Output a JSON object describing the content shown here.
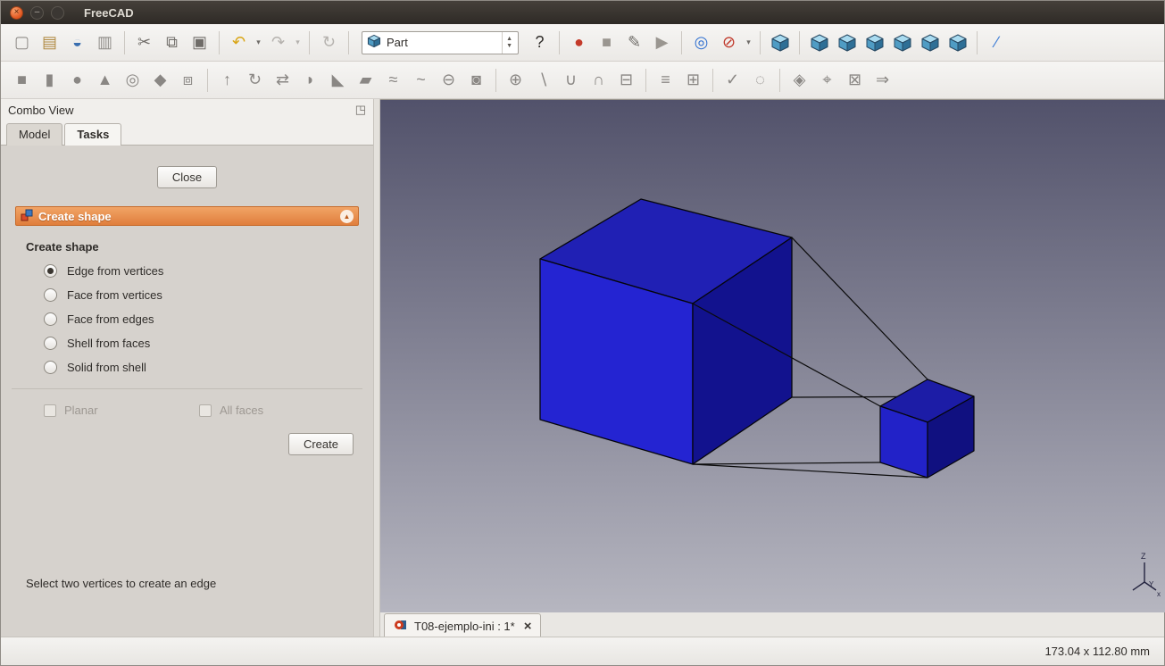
{
  "window": {
    "title": "FreeCAD"
  },
  "toolbar_main": {
    "left": [
      {
        "n": "new-document",
        "g": "▢",
        "c": "#8f8c88"
      },
      {
        "n": "open-document",
        "g": "▤",
        "c": "#b08a42"
      },
      {
        "n": "save-document",
        "g": "◒",
        "c": "#3a6fb0"
      },
      {
        "n": "print",
        "g": "▥",
        "c": "#8f8c88"
      },
      {
        "sep": true
      },
      {
        "n": "cut",
        "g": "✂",
        "c": "#6f6c68"
      },
      {
        "n": "copy",
        "g": "⧉",
        "c": "#6f6c68"
      },
      {
        "n": "paste",
        "g": "▣",
        "c": "#6f6c68"
      },
      {
        "sep": true
      },
      {
        "n": "undo",
        "g": "↶",
        "c": "#d9a514"
      },
      {
        "n": "undo-dropdown",
        "g": "▾",
        "c": "#6f6c68",
        "arrow": true
      },
      {
        "n": "redo",
        "g": "↷",
        "c": "#b5b2ae"
      },
      {
        "n": "redo-dropdown",
        "g": "▾",
        "c": "#b5b2ae",
        "arrow": true
      },
      {
        "sep": true
      },
      {
        "n": "refresh",
        "g": "↻",
        "c": "#b5b2ae"
      },
      {
        "sep": true
      }
    ],
    "workbench": {
      "value": "Part"
    },
    "right": [
      {
        "n": "whats-this",
        "g": "?",
        "c": "#2f2c29"
      },
      {
        "sep": true
      },
      {
        "n": "macro-record",
        "g": "●",
        "c": "#c43a2a"
      },
      {
        "n": "macro-stop",
        "g": "■",
        "c": "#9a9690"
      },
      {
        "n": "macro-edit",
        "g": "✎",
        "c": "#6f6c68"
      },
      {
        "n": "macro-execute",
        "g": "▶",
        "c": "#9a9690"
      },
      {
        "sep": true
      },
      {
        "n": "fit-all",
        "g": "◎",
        "c": "#2f6fd0"
      },
      {
        "n": "draw-style",
        "g": "⊘",
        "c": "#c0392b"
      },
      {
        "n": "draw-style-dropdown",
        "g": "▾",
        "c": "#6f6c68",
        "arrow": true
      },
      {
        "sep": true
      },
      {
        "n": "view-axonometric",
        "cube": true
      },
      {
        "sep": true
      },
      {
        "n": "view-front",
        "cube": true
      },
      {
        "n": "view-top",
        "cube": true
      },
      {
        "n": "view-right",
        "cube": true
      },
      {
        "n": "view-rear",
        "cube": true
      },
      {
        "n": "view-bottom",
        "cube": true
      },
      {
        "n": "view-left",
        "cube": true
      },
      {
        "sep": true
      },
      {
        "n": "measure-distance",
        "g": "∕",
        "c": "#3a7bd5"
      }
    ]
  },
  "toolbar_part": {
    "items": [
      {
        "n": "part-box",
        "g": "■",
        "c": "#8a8784"
      },
      {
        "n": "part-cylinder",
        "g": "▮",
        "c": "#8a8784"
      },
      {
        "n": "part-sphere",
        "g": "●",
        "c": "#8a8784"
      },
      {
        "n": "part-cone",
        "g": "▲",
        "c": "#8a8784"
      },
      {
        "n": "part-torus",
        "g": "◎",
        "c": "#8a8784"
      },
      {
        "n": "part-primitives",
        "g": "◆",
        "c": "#8a8784"
      },
      {
        "n": "part-shape-builder",
        "g": "⧈",
        "c": "#8a8784"
      },
      {
        "sep": true
      },
      {
        "n": "part-extrude",
        "g": "↑",
        "c": "#8a8784"
      },
      {
        "n": "part-revolve",
        "g": "↻",
        "c": "#8a8784"
      },
      {
        "n": "part-mirror",
        "g": "⇄",
        "c": "#8a8784"
      },
      {
        "n": "part-fillet",
        "g": "◗",
        "c": "#8a8784"
      },
      {
        "n": "part-chamfer",
        "g": "◣",
        "c": "#8a8784"
      },
      {
        "n": "part-ruled-surface",
        "g": "▰",
        "c": "#8a8784"
      },
      {
        "n": "part-loft",
        "g": "≈",
        "c": "#8a8784"
      },
      {
        "n": "part-sweep",
        "g": "~",
        "c": "#8a8784"
      },
      {
        "n": "part-offset",
        "g": "⊖",
        "c": "#8a8784"
      },
      {
        "n": "part-thickness",
        "g": "◙",
        "c": "#8a8784"
      },
      {
        "sep": true
      },
      {
        "n": "part-boolean",
        "g": "⊕",
        "c": "#8a8784"
      },
      {
        "n": "part-cut",
        "g": "∖",
        "c": "#8a8784"
      },
      {
        "n": "part-union",
        "g": "∪",
        "c": "#8a8784"
      },
      {
        "n": "part-intersection",
        "g": "∩",
        "c": "#8a8784"
      },
      {
        "n": "part-section",
        "g": "⊟",
        "c": "#8a8784"
      },
      {
        "sep": true
      },
      {
        "n": "part-cross-sections",
        "g": "≡",
        "c": "#8a8784"
      },
      {
        "n": "part-compound",
        "g": "⊞",
        "c": "#8a8784"
      },
      {
        "sep": true
      },
      {
        "n": "part-check-geometry",
        "g": "✓",
        "c": "#8a8784"
      },
      {
        "n": "part-defeaturing",
        "g": "◌",
        "c": "#8a8784"
      },
      {
        "sep": true
      },
      {
        "n": "part-refine-shape",
        "g": "◈",
        "c": "#8a8784"
      },
      {
        "n": "part-edit-attachment",
        "g": "⌖",
        "c": "#8a8784"
      },
      {
        "n": "part-explode-compound",
        "g": "⊠",
        "c": "#8a8784"
      },
      {
        "n": "part-migrate-sketch",
        "g": "⇒",
        "c": "#8a8784"
      }
    ]
  },
  "combo_view": {
    "title": "Combo View",
    "tabs": [
      {
        "label": "Model",
        "active": false
      },
      {
        "label": "Tasks",
        "active": true
      }
    ],
    "close_button": "Close",
    "panel": {
      "header": "Create shape",
      "section_title": "Create shape",
      "radios": [
        {
          "label": "Edge from vertices",
          "selected": true
        },
        {
          "label": "Face from vertices",
          "selected": false
        },
        {
          "label": "Face from edges",
          "selected": false
        },
        {
          "label": "Shell from faces",
          "selected": false
        },
        {
          "label": "Solid from shell",
          "selected": false
        }
      ],
      "checkboxes": [
        {
          "label": "Planar",
          "checked": false,
          "enabled": false
        },
        {
          "label": "All faces",
          "checked": false,
          "enabled": false
        }
      ],
      "create_button": "Create",
      "hint": "Select two vertices to create an edge"
    }
  },
  "viewport": {
    "axis": {
      "z": "Z",
      "y": "Y",
      "x": "x"
    }
  },
  "mdi": {
    "tab_label": "T08-ejemplo-ini : 1*"
  },
  "status_bar": {
    "dimensions": "173.04 x 112.80 mm"
  }
}
